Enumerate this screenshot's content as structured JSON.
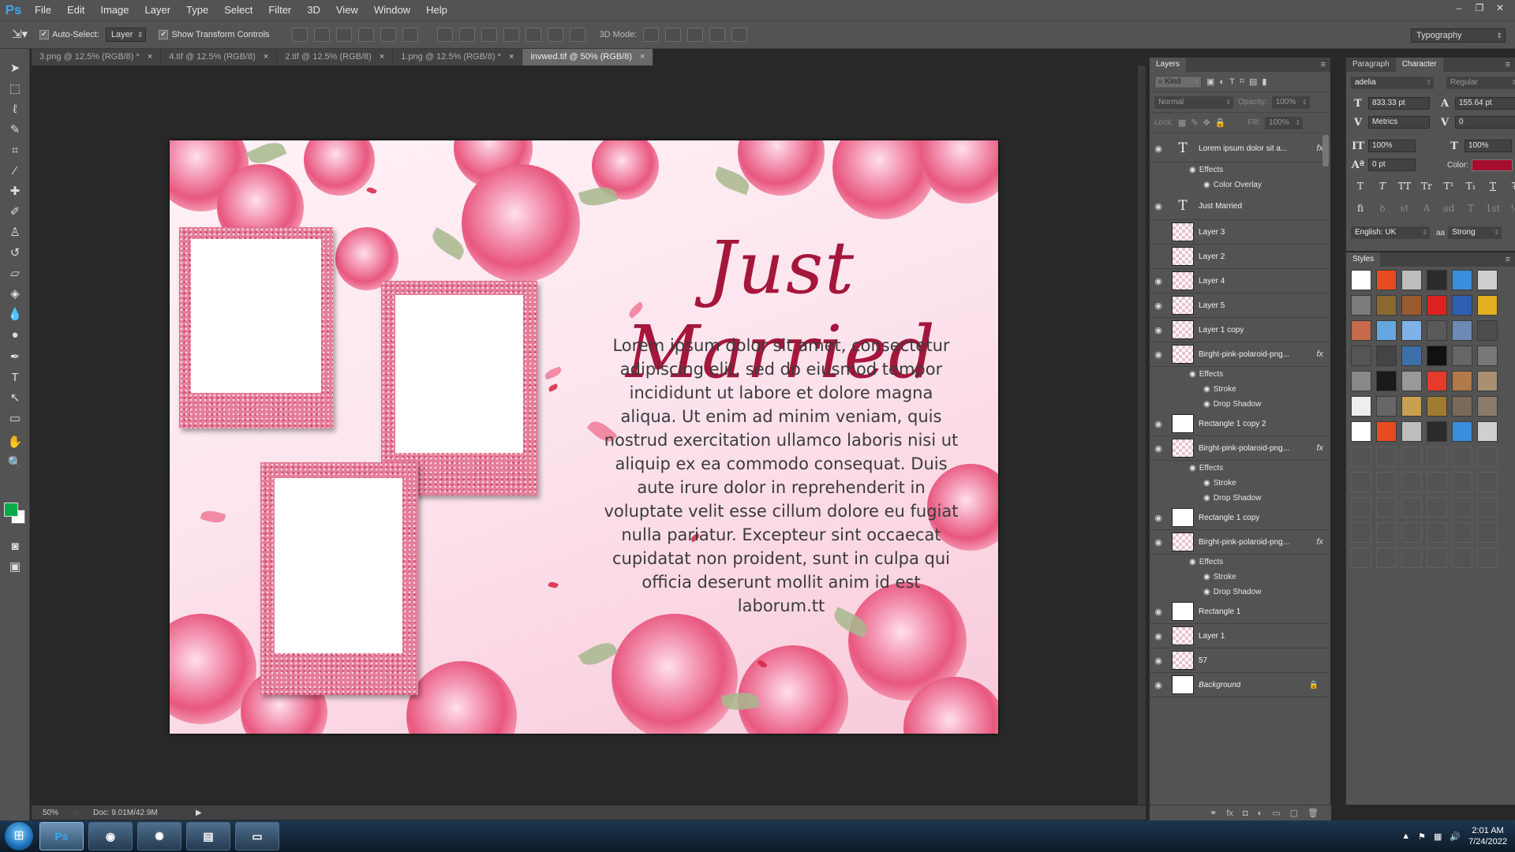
{
  "app": {
    "logo": "Ps",
    "menu": [
      "File",
      "Edit",
      "Image",
      "Layer",
      "Type",
      "Select",
      "Filter",
      "3D",
      "View",
      "Window",
      "Help"
    ],
    "window_controls": [
      "–",
      "❐",
      "✕"
    ]
  },
  "options_bar": {
    "auto_select_label": "Auto-Select:",
    "auto_select_checked": true,
    "auto_select_target": "Layer",
    "show_transform_label": "Show Transform Controls",
    "show_transform_checked": true,
    "mode_3d_label": "3D Mode:",
    "workspace": "Typography"
  },
  "tools": [
    "move-icon",
    "marquee-icon",
    "lasso-icon",
    "quick-select-icon",
    "crop-icon",
    "eyedropper-icon",
    "healing-icon",
    "brush-icon",
    "clone-stamp-icon",
    "history-brush-icon",
    "eraser-icon",
    "paint-bucket-icon",
    "blur-icon",
    "dodge-icon",
    "pen-icon",
    "type-icon",
    "path-select-icon",
    "rectangle-icon",
    "hand-icon",
    "zoom-icon"
  ],
  "colors": {
    "foreground": "#0aaa4a",
    "background": "#ffffff",
    "text_color": "#a50e2e",
    "accent": "#3ba7f0"
  },
  "doc_tabs": [
    {
      "label": "3.png @ 12.5% (RGB/8) *",
      "active": false
    },
    {
      "label": "4.tif @ 12.5% (RGB/8)",
      "active": false
    },
    {
      "label": "2.tif @ 12.5% (RGB/8)",
      "active": false
    },
    {
      "label": "1.png @ 12.5% (RGB/8) *",
      "active": false
    },
    {
      "label": "invwed.tif @ 50% (RGB/8)",
      "active": true
    }
  ],
  "artwork": {
    "title": "Just Married",
    "body": "Lorem ipsum dolor sit amet, consectetur adipiscing elit, sed do eiusmod tempor incididunt ut labore et dolore magna aliqua. Ut enim ad minim veniam, quis nostrud exercitation ullamco laboris nisi ut aliquip ex ea commodo consequat. Duis aute irure dolor in reprehenderit in voluptate velit esse cillum dolore eu fugiat nulla pariatur. Excepteur sint occaecat cupidatat non proident, sunt in culpa qui officia deserunt mollit anim id est laborum.tt"
  },
  "status_bar": {
    "zoom": "50%",
    "doc": "Doc: 9.01M/42.9M"
  },
  "layers_panel": {
    "tab": "Layers",
    "filter_kind": "Kind",
    "blend_mode": "Normal",
    "opacity_label": "Opacity:",
    "opacity": "100%",
    "lock_label": "Lock:",
    "fill_label": "Fill:",
    "fill": "100%",
    "effects_label": "Effects",
    "layers": [
      {
        "name": "Lorem ipsum dolor sit a...",
        "type": "text",
        "visible": true,
        "fx": true,
        "effects": [
          "Color Overlay"
        ]
      },
      {
        "name": "Just Married",
        "type": "text",
        "visible": true,
        "fx": false,
        "effects": []
      },
      {
        "name": "Layer 3",
        "type": "checker",
        "visible": false,
        "fx": false,
        "effects": []
      },
      {
        "name": "Layer 2",
        "type": "checker",
        "visible": false,
        "fx": false,
        "effects": []
      },
      {
        "name": "Layer 4",
        "type": "checker",
        "visible": true,
        "fx": false,
        "effects": []
      },
      {
        "name": "Layer 5",
        "type": "checker",
        "visible": true,
        "fx": false,
        "effects": []
      },
      {
        "name": "Layer 1 copy",
        "type": "checker",
        "visible": true,
        "fx": false,
        "effects": []
      },
      {
        "name": "Birght-pink-polaroid-png...",
        "type": "smart",
        "visible": true,
        "fx": true,
        "effects": [
          "Stroke",
          "Drop Shadow"
        ]
      },
      {
        "name": "Rectangle 1 copy 2",
        "type": "white",
        "visible": true,
        "fx": false,
        "effects": []
      },
      {
        "name": "Birght-pink-polaroid-png...",
        "type": "smart",
        "visible": true,
        "fx": true,
        "effects": [
          "Stroke",
          "Drop Shadow"
        ]
      },
      {
        "name": "Rectangle 1 copy",
        "type": "white",
        "visible": true,
        "fx": false,
        "effects": []
      },
      {
        "name": "Birght-pink-polaroid-png...",
        "type": "smart",
        "visible": true,
        "fx": true,
        "effects": [
          "Stroke",
          "Drop Shadow"
        ]
      },
      {
        "name": "Rectangle 1",
        "type": "white",
        "visible": true,
        "fx": false,
        "effects": []
      },
      {
        "name": "Layer 1",
        "type": "checker",
        "visible": true,
        "fx": false,
        "effects": []
      },
      {
        "name": "57",
        "type": "smart",
        "visible": true,
        "fx": false,
        "effects": []
      },
      {
        "name": "Background",
        "type": "white",
        "visible": true,
        "fx": false,
        "effects": [],
        "locked": true
      }
    ]
  },
  "character_panel": {
    "tabs": [
      "Paragraph",
      "Character"
    ],
    "active_tab": "Character",
    "font_family": "adelia",
    "font_style": "Regular",
    "font_size": "833.33 pt",
    "leading": "155.64 pt",
    "kerning": "Metrics",
    "tracking": "0",
    "vertical_scale": "100%",
    "horizontal_scale": "100%",
    "baseline_shift": "0 pt",
    "color_label": "Color:",
    "type_buttons": [
      "T",
      "T",
      "TT",
      "Tr",
      "T¹",
      "T₁",
      "T",
      "T̶"
    ],
    "opentype_buttons": [
      "fi",
      "ꝺ",
      "st",
      "A",
      "ad",
      "T",
      "1st",
      "½"
    ],
    "language": "English: UK",
    "antialias_icon": "aa",
    "antialias": "Strong"
  },
  "styles_panel": {
    "title": "Styles"
  },
  "taskbar": {
    "apps": [
      "Ps",
      "chrome-icon",
      "app-icon",
      "folder-icon",
      "window-icon"
    ],
    "time": "2:01 AM",
    "date": "7/24/2022"
  }
}
